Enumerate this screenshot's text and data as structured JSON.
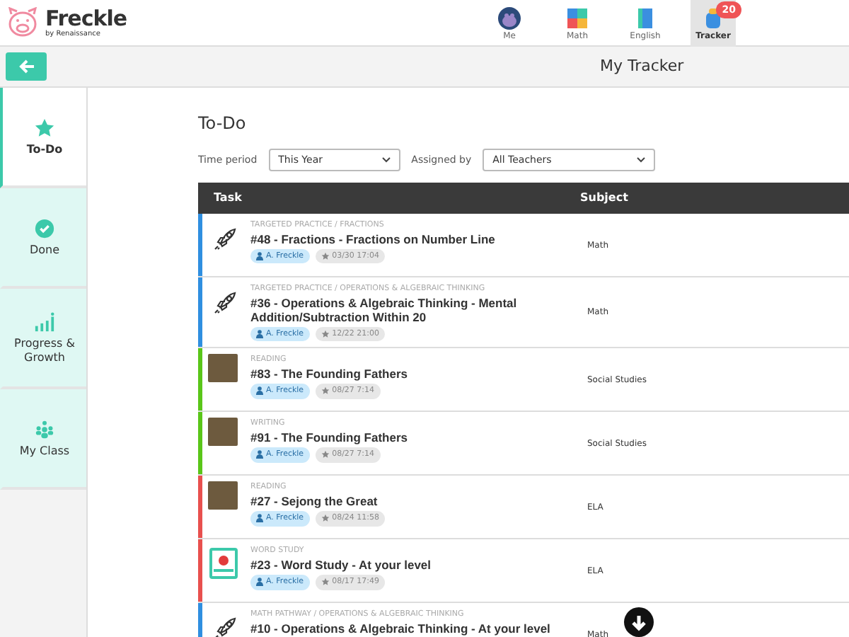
{
  "brand": {
    "name": "Freckle",
    "byline": "by Renaissance"
  },
  "nav": [
    {
      "label": "Me",
      "kind": "avatar",
      "selected": false
    },
    {
      "label": "Math",
      "kind": "math",
      "selected": false
    },
    {
      "label": "English",
      "kind": "book",
      "selected": false
    },
    {
      "label": "Tracker",
      "kind": "backpack",
      "selected": true,
      "badge": "20"
    }
  ],
  "page_title": "My Tracker",
  "sidebar": [
    {
      "label": "To-Do",
      "kind": "star",
      "selected": true
    },
    {
      "label": "Done",
      "kind": "check",
      "selected": false
    },
    {
      "label": "Progress & Growth",
      "kind": "chart",
      "selected": false
    },
    {
      "label": "My Class",
      "kind": "people",
      "selected": false
    }
  ],
  "heading": "To-Do",
  "filters": [
    {
      "label": "Time period",
      "value": "This Year"
    },
    {
      "label": "Assigned by",
      "value": "All Teachers"
    }
  ],
  "table": {
    "columns": [
      "Task",
      "Subject"
    ],
    "rows": [
      {
        "kind": "rocket",
        "color": "#2f8fe0",
        "category": "TARGETED PRACTICE / FRACTIONS",
        "title": "#48 - Fractions - Fractions on Number Line",
        "assignee": "A. Freckle",
        "date": "03/30 17:04",
        "subject": "Math"
      },
      {
        "kind": "rocket",
        "color": "#2f8fe0",
        "category": "TARGETED PRACTICE / OPERATIONS & ALGEBRAIC THINKING",
        "title": "#36 - Operations & Algebraic Thinking - Mental Addition/Subtraction Within 20",
        "assignee": "A. Freckle",
        "date": "12/22 21:00",
        "subject": "Math"
      },
      {
        "kind": "photo",
        "color": "#5ac619",
        "category": "READING",
        "title": "#83 - The Founding Fathers",
        "assignee": "A. Freckle",
        "date": "08/27 7:14",
        "subject": "Social Studies"
      },
      {
        "kind": "photo",
        "color": "#5ac619",
        "category": "WRITING",
        "title": "#91 - The Founding Fathers",
        "assignee": "A. Freckle",
        "date": "08/27 7:14",
        "subject": "Social Studies"
      },
      {
        "kind": "photo",
        "color": "#e8504e",
        "category": "READING",
        "title": "#27 - Sejong the Great",
        "assignee": "A. Freckle",
        "date": "08/24 11:58",
        "subject": "ELA"
      },
      {
        "kind": "wordstudy",
        "color": "#e8504e",
        "category": "WORD STUDY",
        "title": "#23 - Word Study - At your level",
        "assignee": "A. Freckle",
        "date": "08/17 17:49",
        "subject": "ELA"
      },
      {
        "kind": "rocket",
        "color": "#2f8fe0",
        "category": "MATH PATHWAY / OPERATIONS & ALGEBRAIC THINKING",
        "title": "#10 - Operations & Algebraic Thinking - At your level",
        "subject": "Math"
      }
    ]
  }
}
